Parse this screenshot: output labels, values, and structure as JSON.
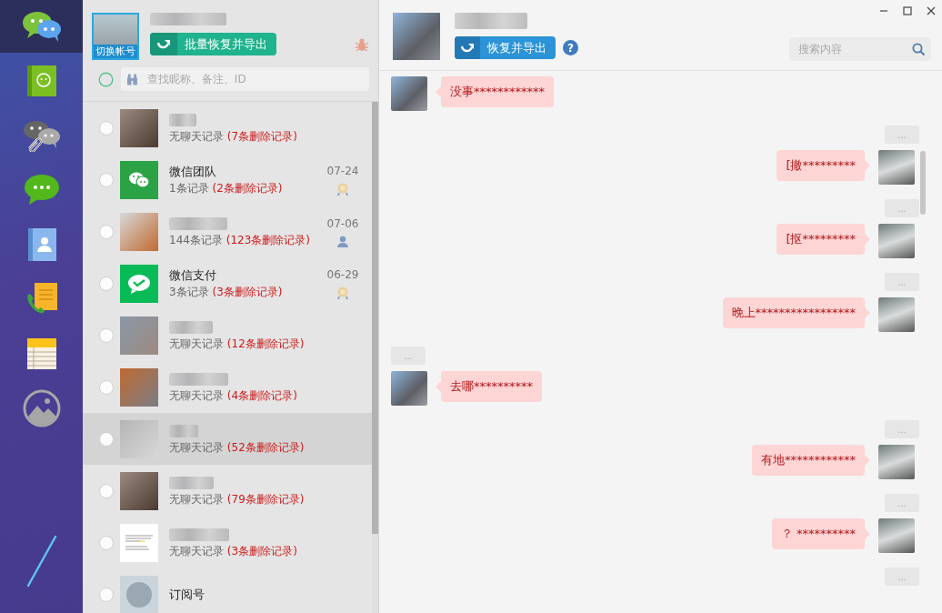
{
  "sidebar": {
    "items": [
      {
        "kind": "dual-chat",
        "selected": true
      },
      {
        "kind": "green-book",
        "selected": false
      },
      {
        "kind": "linked-chat",
        "selected": false
      },
      {
        "kind": "green-chat",
        "selected": false
      },
      {
        "kind": "contact-book",
        "selected": false
      },
      {
        "kind": "phone-note",
        "selected": false
      },
      {
        "kind": "notepad",
        "selected": false
      },
      {
        "kind": "gallery",
        "selected": false
      }
    ]
  },
  "account": {
    "switch_label": "切换帐号",
    "batch_button": "批量恢复并导出",
    "search_placeholder": "查找昵称、备注、ID"
  },
  "contacts": [
    {
      "kind": "photo",
      "summary": "无聊天记录",
      "deleted": "(7条删除记录)",
      "selected": false
    },
    {
      "kind": "wechat",
      "name": "微信团队",
      "summary": "1条记录",
      "deleted": "(2条删除记录)",
      "date": "07-24",
      "badge": {
        "kind": "medal"
      },
      "selected": false
    },
    {
      "kind": "photo",
      "summary": "144条记录",
      "deleted": "(123条删除记录)",
      "date": "07-06",
      "badge": {
        "kind": "person"
      },
      "selected": false
    },
    {
      "kind": "wechat-pay",
      "name": "微信支付",
      "summary": "3条记录",
      "deleted": "(3条删除记录)",
      "date": "06-29",
      "badge": {
        "kind": "medal"
      },
      "selected": false
    },
    {
      "kind": "photo",
      "summary": "无聊天记录",
      "deleted": "(12条删除记录)",
      "selected": false
    },
    {
      "kind": "photo",
      "summary": "无聊天记录",
      "deleted": "(4条删除记录)",
      "selected": false
    },
    {
      "kind": "photo",
      "summary": "无聊天记录",
      "deleted": "(52条删除记录)",
      "selected": true
    },
    {
      "kind": "photo",
      "summary": "无聊天记录",
      "deleted": "(79条删除记录)",
      "selected": false
    },
    {
      "kind": "document",
      "summary": "无聊天记录",
      "deleted": "(3条删除记录)",
      "selected": false
    },
    {
      "kind": "round",
      "name": "订阅号",
      "selected": false
    }
  ],
  "chat": {
    "export_button": "恢复并导出",
    "help_label": "?",
    "search_placeholder": "搜索内容",
    "messages": [
      {
        "kind": "message",
        "outgoing": false,
        "text": "没事************"
      },
      {
        "kind": "time",
        "text": "..."
      },
      {
        "kind": "message",
        "outgoing": true,
        "text": "[撤*********"
      },
      {
        "kind": "time",
        "text": "..."
      },
      {
        "kind": "message",
        "outgoing": true,
        "text": "[抠*********"
      },
      {
        "kind": "time",
        "text": "..."
      },
      {
        "kind": "message",
        "outgoing": true,
        "text": "晚上*****************"
      },
      {
        "kind": "time",
        "text": "..."
      },
      {
        "kind": "message",
        "outgoing": false,
        "text": "去哪**********"
      },
      {
        "kind": "time",
        "text": "..."
      },
      {
        "kind": "message",
        "outgoing": true,
        "text": "有地************"
      },
      {
        "kind": "time",
        "text": "..."
      },
      {
        "kind": "message",
        "outgoing": true,
        "text": "？ **********"
      },
      {
        "kind": "time",
        "text": "..."
      }
    ]
  }
}
